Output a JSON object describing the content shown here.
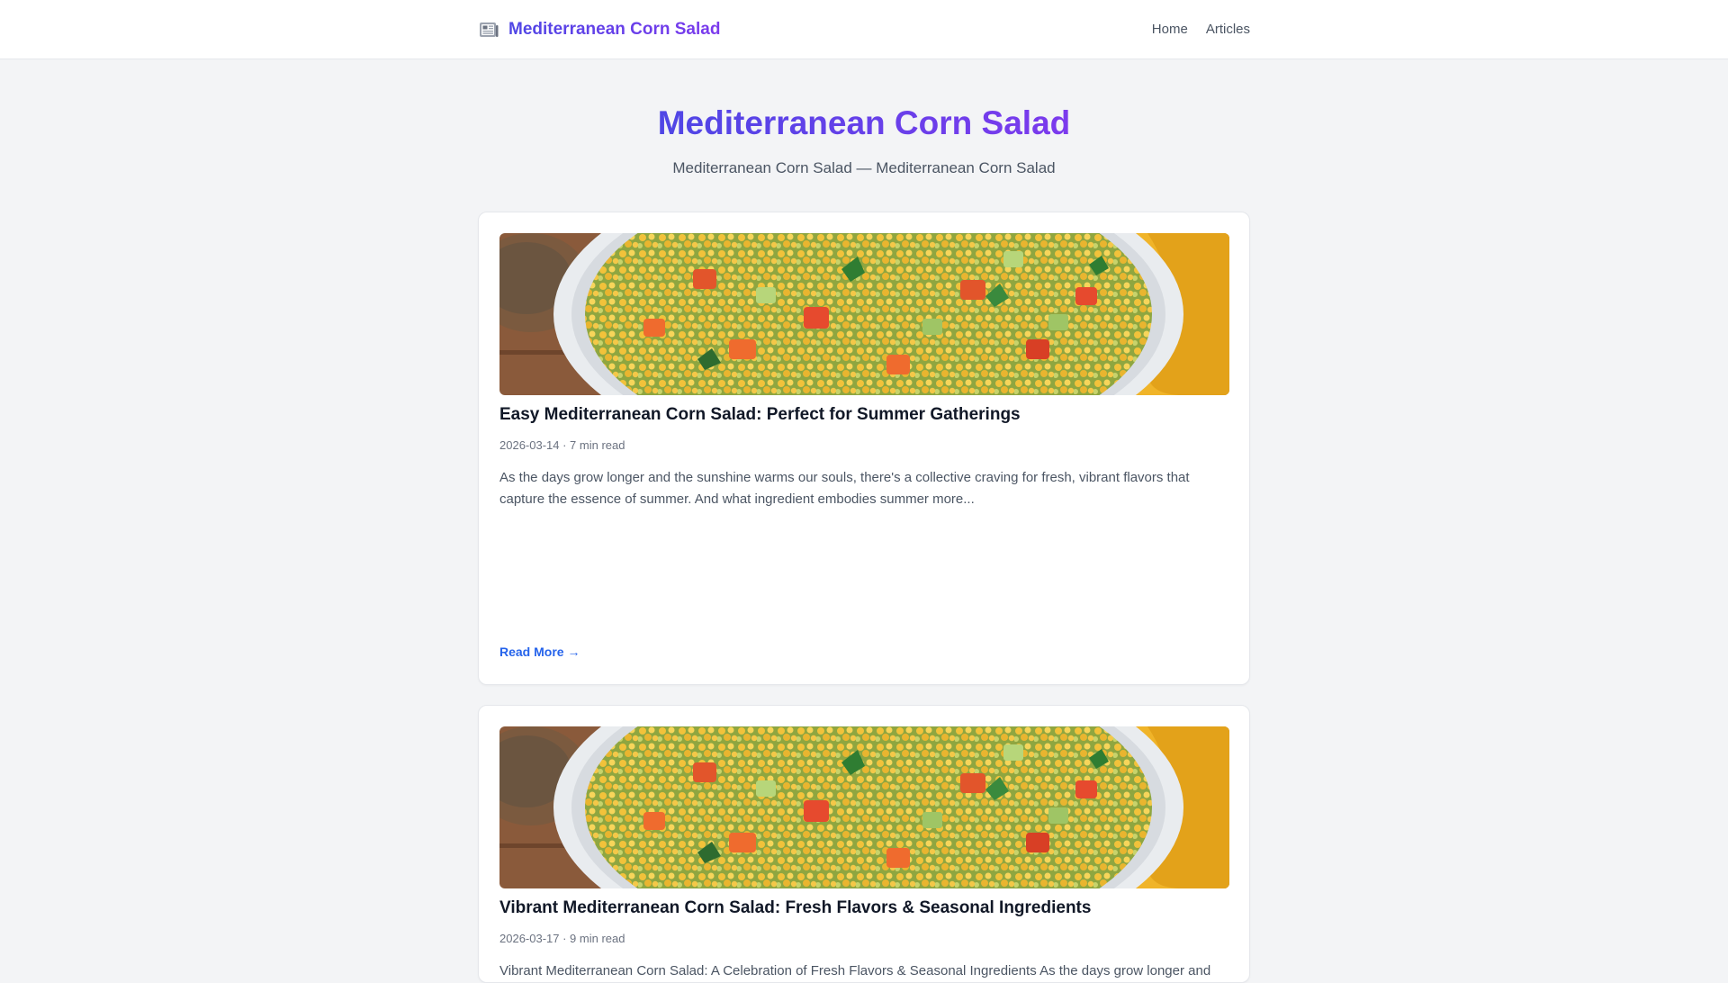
{
  "header": {
    "brand_icon": "newspaper-icon",
    "brand_name": "Mediterranean Corn Salad",
    "nav": [
      {
        "label": "Home"
      },
      {
        "label": "Articles"
      }
    ]
  },
  "hero": {
    "title": "Mediterranean Corn Salad",
    "subtitle": "Mediterranean Corn Salad — Mediterranean Corn Salad"
  },
  "articles": [
    {
      "title": "Easy Mediterranean Corn Salad: Perfect for Summer Gatherings",
      "meta": "2026-03-14 · 7 min read",
      "excerpt": "As the days grow longer and the sunshine warms our souls, there's a collective craving for fresh, vibrant flavors that capture the essence of summer. And what ingredient embodies summer more...",
      "read_more": "Read More →"
    },
    {
      "title": "Vibrant Mediterranean Corn Salad: Fresh Flavors & Seasonal Ingredients",
      "meta": "2026-03-17 · 9 min read",
      "excerpt": "Vibrant Mediterranean Corn Salad: A Celebration of Fresh Flavors & Seasonal Ingredients As the days grow longer and"
    }
  ],
  "colors": {
    "brand_gradient_start": "#4f46e5",
    "brand_gradient_end": "#7c3aed",
    "link": "#2563eb",
    "page_background": "#f3f4f6"
  }
}
